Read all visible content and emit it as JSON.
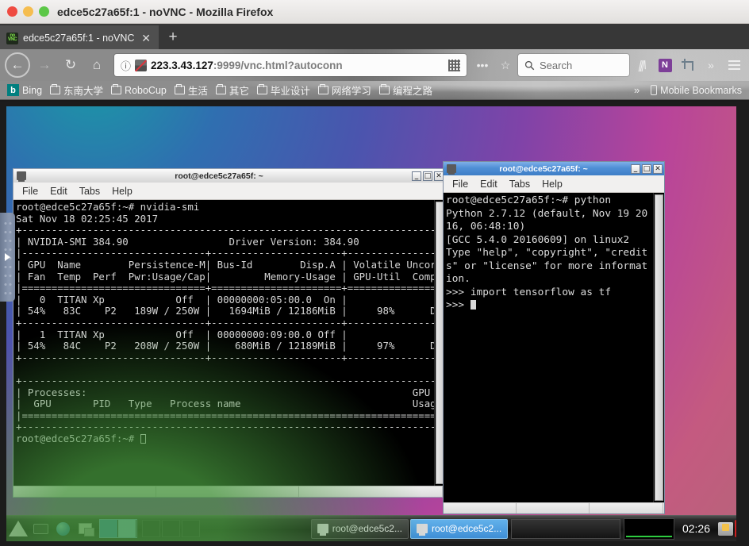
{
  "browser": {
    "window_title": "edce5c27a65f:1 - noVNC - Mozilla Firefox",
    "tab": {
      "label": "edce5c27a65f:1 - noVNC",
      "close": "✕",
      "favicon": "novnc-favicon"
    },
    "new_tab": "+",
    "nav": {
      "back": "←",
      "forward": "→",
      "reload": "↻",
      "home": "⌂"
    },
    "url": {
      "info_icon": "ⓘ",
      "host": "223.3.43.127",
      "rest": ":9999/vnc.html?autoconn",
      "full": "223.3.43.127:9999/vnc.html?autoconn"
    },
    "toolbar": {
      "qr_title": "qr-code",
      "page_actions": "•••",
      "bookmark_star": "☆",
      "search_placeholder": "Search",
      "library": "library-icon",
      "onenote": "N",
      "screenshot": "crop-icon",
      "overflow": "»",
      "menu": "menu-icon"
    },
    "bookmarks": [
      {
        "label": "Bing",
        "type": "bing"
      },
      {
        "label": "东南大学",
        "type": "folder"
      },
      {
        "label": "RoboCup",
        "type": "folder"
      },
      {
        "label": "生活",
        "type": "folder"
      },
      {
        "label": "其它",
        "type": "folder"
      },
      {
        "label": "毕业设计",
        "type": "folder"
      },
      {
        "label": "网络学习",
        "type": "folder"
      },
      {
        "label": "编程之路",
        "type": "folder"
      }
    ],
    "bookmarks_overflow": "»",
    "mobile_bookmarks": "Mobile Bookmarks"
  },
  "vnc": {
    "handle_arrow": "▶"
  },
  "terminal_nvidia": {
    "title": "root@edce5c27a65f: ~",
    "icon": "terminal-icon",
    "buttons": {
      "minimize": "_",
      "maximize": "□",
      "close": "✕"
    },
    "menus": [
      "File",
      "Edit",
      "Tabs",
      "Help"
    ],
    "content": "root@edce5c27a65f:~# nvidia-smi\nSat Nov 18 02:25:45 2017\n+-----------------------------------------------------------------------------+\n| NVIDIA-SMI 384.90                 Driver Version: 384.90                    |\n|-------------------------------+----------------------+----------------------+\n| GPU  Name        Persistence-M| Bus-Id        Disp.A | Volatile Uncorr. ECC |\n| Fan  Temp  Perf  Pwr:Usage/Cap|         Memory-Usage | GPU-Util  Compute M. |\n|===============================+======================+======================|\n|   0  TITAN Xp            Off  | 00000000:05:00.0  On |                  N/A |\n| 54%   83C    P2   189W / 250W |   1694MiB / 12186MiB |     98%      Default |\n+-------------------------------+----------------------+----------------------+\n|   1  TITAN Xp            Off  | 00000000:09:00.0 Off |                  N/A |\n| 54%   84C    P2   208W / 250W |    680MiB / 12189MiB |     97%      Default |\n+-------------------------------+----------------------+----------------------+\n\n+-----------------------------------------------------------------------------+\n| Processes:                                                       GPU Memory |\n|  GPU       PID   Type   Process name                             Usage      |\n|=============================================================================|\n+-----------------------------------------------------------------------------+\nroot@edce5c27a65f:~# "
  },
  "terminal_python": {
    "title": "root@edce5c27a65f: ~",
    "icon": "terminal-icon",
    "buttons": {
      "minimize": "_",
      "maximize": "□",
      "close": "✕"
    },
    "menus": [
      "File",
      "Edit",
      "Tabs",
      "Help"
    ],
    "content": "root@edce5c27a65f:~# python\nPython 2.7.12 (default, Nov 19 20\n16, 06:48:10)\n[GCC 5.4.0 20160609] on linux2\nType \"help\", \"copyright\", \"credit\ns\" or \"license\" for more informat\nion.\n>>> import tensorflow as tf\n>>> "
  },
  "taskbar": {
    "launchers": [
      "arch-logo",
      "terminal-launcher",
      "browser-launcher",
      "files-launcher"
    ],
    "workspaces": [
      "1",
      "2",
      "3",
      "4",
      "5"
    ],
    "tasks": [
      {
        "label": "root@edce5c2...",
        "active": false
      },
      {
        "label": "root@edce5c2...",
        "active": true
      }
    ],
    "clock": "02:26",
    "lock": "lock-icon",
    "power": "⏻"
  },
  "colors": {
    "accent": "#3f8ed6",
    "terminal_bg": "#000000",
    "terminal_fg": "#d6d6d6",
    "firefox_chrome": "#8a8a8a",
    "desktop_start": "#1f8fa8",
    "desktop_end": "#b8637a"
  }
}
